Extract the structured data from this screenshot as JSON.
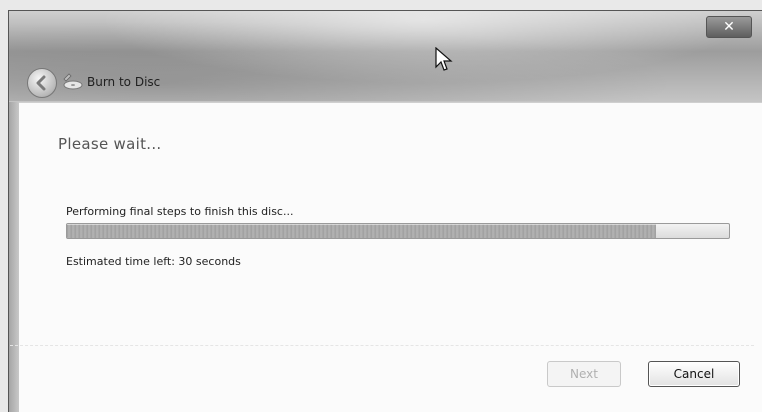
{
  "window": {
    "title": "Burn to Disc",
    "close_label": "✕"
  },
  "main": {
    "heading": "Please wait...",
    "status_text": "Performing final steps to finish this disc...",
    "progress": 0.89,
    "time_left": "Estimated time left: 30 seconds"
  },
  "buttons": {
    "next_label": "Next",
    "cancel_label": "Cancel"
  },
  "icons": {
    "back": "back-arrow-icon",
    "disc": "burn-disc-icon",
    "close": "close-icon",
    "cursor": "mouse-cursor-icon"
  }
}
